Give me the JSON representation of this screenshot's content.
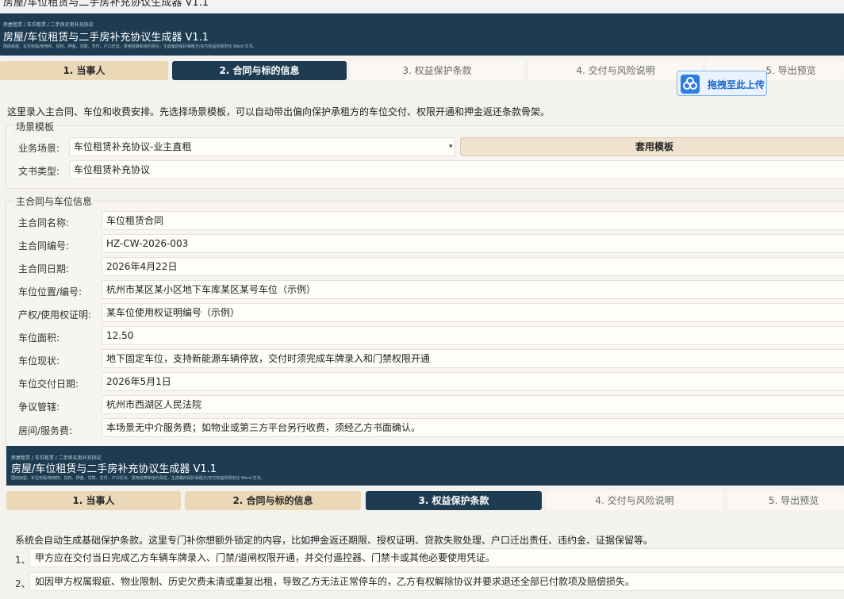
{
  "window": {
    "title": "房屋/车位租赁与二手房补充协议生成器 V1.1"
  },
  "header": {
    "breadcrumb": "房屋租赁 / 车位租赁 / 二手房买卖补充协议",
    "title": "房屋/车位租赁与二手房补充协议生成器 V1.1",
    "subtitle": "围绕房屋、车位权属/使用权、授权、押金、贷款、交付、户口迁出、费用结算和违约责任，生成偏向保护承租方/买方权益的规范化 Word 文书。"
  },
  "tabs": [
    {
      "label": "1. 当事人"
    },
    {
      "label": "2. 合同与标的信息"
    },
    {
      "label": "3. 权益保护条款"
    },
    {
      "label": "4. 交付与风险说明"
    },
    {
      "label": "5. 导出预览"
    }
  ],
  "upload": {
    "label": "拖拽至此上传"
  },
  "intro": "这里录入主合同、车位和收费安排。先选择场景模板，可以自动带出偏向保护承租方的车位交付、权限开通和押金返还条款骨架。",
  "scene": {
    "legend": "场景模板",
    "business_label": "业务场景:",
    "business_value": "车位租赁补充协议-业主直租",
    "apply_button": "套用模板",
    "doctype_label": "文书类型:",
    "doctype_value": "车位租赁补充协议"
  },
  "main": {
    "legend": "主合同与车位信息",
    "fields": [
      {
        "label": "主合同名称:",
        "value": "车位租赁合同"
      },
      {
        "label": "主合同编号:",
        "value": "HZ-CW-2026-003"
      },
      {
        "label": "主合同日期:",
        "value": "2026年4月22日"
      },
      {
        "label": "车位位置/编号:",
        "value": "杭州市某区某小区地下车库某区某号车位（示例）"
      },
      {
        "label": "产权/使用权证明:",
        "value": "某车位使用权证明编号（示例）"
      },
      {
        "label": "车位面积:",
        "value": "12.50"
      },
      {
        "label": "车位现状:",
        "value": "地下固定车位，支持新能源车辆停放，交付时须完成车牌录入和门禁权限开通"
      },
      {
        "label": "车位交付日期:",
        "value": "2026年5月1日"
      },
      {
        "label": "争议管辖:",
        "value": "杭州市西湖区人民法院"
      },
      {
        "label": "居间/服务费:",
        "value": "本场景无中介服务费；如物业或第三方平台另行收费，须经乙方书面确认。"
      }
    ]
  },
  "page2": {
    "breadcrumb": "房屋租赁 / 车位租赁 / 二手房买卖补充协议",
    "title": "房屋/车位租赁与二手房补充协议生成器 V1.1",
    "subtitle": "围绕房屋、车位权属/使用权、授权、押金、贷款、交付、户口迁出、费用结算和违约责任，生成偏向保护承租方/买方权益的规范化 Word 文书。",
    "intro": "系统会自动生成基础保护条款。这里专门补你想额外锁定的内容，比如押金返还期限、授权证明、贷款失败处理、户口迁出责任、违约金、证据保留等。",
    "clauses": [
      {
        "num": "1、",
        "text": "甲方应在交付当日完成乙方车辆车牌录入、门禁/道闸权限开通，并交付遥控器、门禁卡或其他必要使用凭证。"
      },
      {
        "num": "2、",
        "text": "如因甲方权属瑕疵、物业限制、历史欠费未清或重复出租，导致乙方无法正常停车的，乙方有权解除协议并要求退还全部已付款项及赔偿损失。"
      }
    ]
  }
}
